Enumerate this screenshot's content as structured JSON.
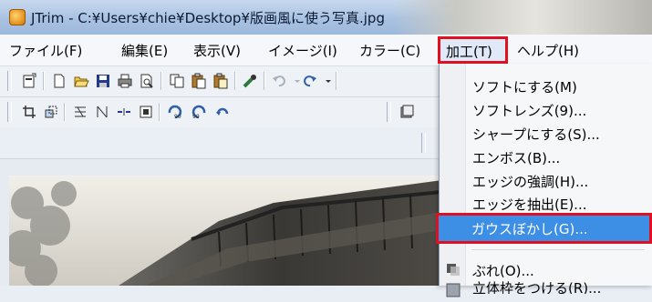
{
  "window": {
    "title": "JTrim - C:¥Users¥chie¥Desktop¥版画風に使う写真.jpg"
  },
  "menubar": {
    "items": [
      {
        "label": "ファイル(F)"
      },
      {
        "label": "編集(E)"
      },
      {
        "label": "表示(V)"
      },
      {
        "label": "イメージ(I)"
      },
      {
        "label": "カラー(C)"
      },
      {
        "label": "加工(T)"
      },
      {
        "label": "ヘルプ(H)"
      }
    ]
  },
  "dropdown": {
    "items": [
      {
        "label": "ソフトにする(M)"
      },
      {
        "label": "ソフトレンズ(9)..."
      },
      {
        "label": "シャープにする(S)..."
      },
      {
        "label": "エンボス(B)..."
      },
      {
        "label": "エッジの強調(H)..."
      },
      {
        "label": "エッジを抽出(E)..."
      },
      {
        "label": "ガウスぼかし(G)..."
      },
      {
        "label": "ぶれ(O)..."
      },
      {
        "label": "立体枠をつける(R)..."
      }
    ],
    "highlighted_index": 6
  },
  "colors": {
    "highlight": "#3d8fe6",
    "annotation_red": "#e01020"
  },
  "icons": {
    "toolbar1": [
      "new-image-icon",
      "new-icon",
      "open-icon",
      "save-icon",
      "print-icon",
      "print-preview-icon",
      "copy-icon",
      "paste-icon",
      "paste-new-icon",
      "eyedropper-icon",
      "undo-icon",
      "redo-icon"
    ],
    "toolbar2": [
      "crop-icon",
      "resize-icon",
      "flip-vertical-icon",
      "flip-horizontal-icon",
      "rotate-icon",
      "fit-icon",
      "rotate-left-90-icon",
      "rotate-right-90-icon",
      "rotate-free-icon"
    ]
  }
}
